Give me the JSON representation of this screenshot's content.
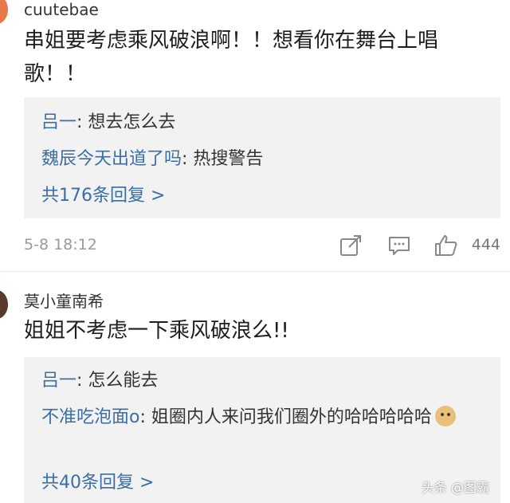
{
  "comments": [
    {
      "username": "cuutebae",
      "text": "串姐要考虑乘风破浪啊！！想看你在舞台上唱歌！！",
      "replies": [
        {
          "name": "吕一",
          "text": ": 想去怎么去"
        },
        {
          "name": "魏辰今天出道了吗",
          "text": ": 热搜警告"
        }
      ],
      "more_replies": "共176条回复 >",
      "timestamp": "5-8 18:12",
      "likes": "444"
    },
    {
      "username": "莫小童南希",
      "text": "姐姐不考虑一下乘风破浪么!!",
      "replies": [
        {
          "name": "吕一",
          "text": ": 怎么能去"
        },
        {
          "name": "不准吃泡面o",
          "text": ": 姐圈内人来问我们圈外的哈哈哈哈哈"
        }
      ],
      "more_replies": "共40条回复 >"
    }
  ],
  "icons": {
    "repost": "repost-icon",
    "comment": "comment-icon",
    "like": "thumbs-up-icon",
    "emoji": "doge-emoji-icon"
  },
  "colors": {
    "reply_name": "#3a6ea5",
    "reply_bg": "#f2f2f2",
    "avatar_1": "#e8774a",
    "avatar_2": "#5a3a2a"
  },
  "watermark": "头条 @图霸"
}
